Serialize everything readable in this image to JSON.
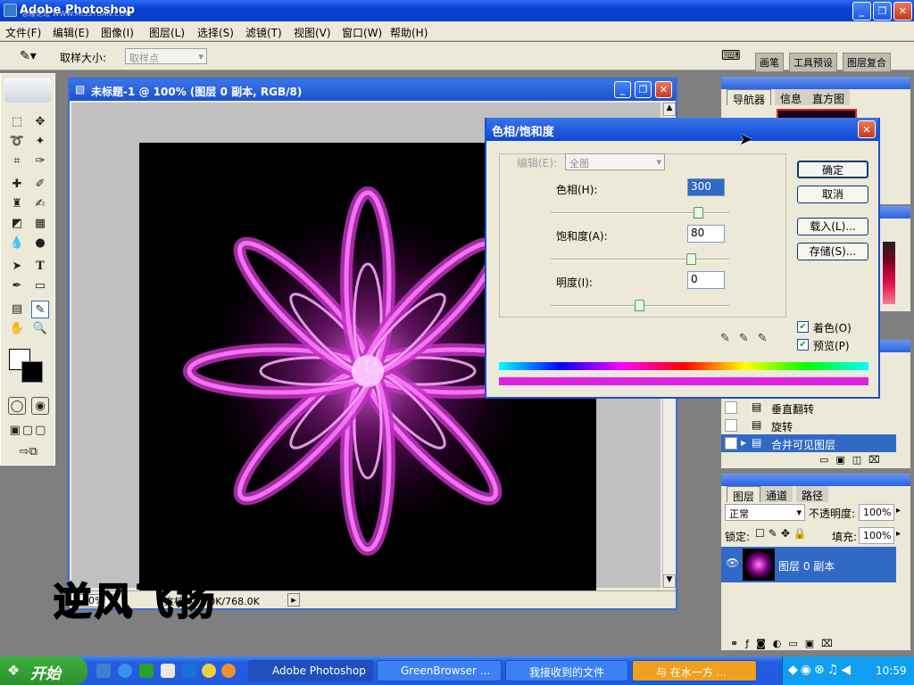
{
  "app": {
    "title": "Adobe Photoshop",
    "watermark": "思缘论坛 WWW.MISSYUAN.COM"
  },
  "menu": [
    "文件(F)",
    "编辑(E)",
    "图像(I)",
    "图层(L)",
    "选择(S)",
    "滤镜(T)",
    "视图(V)",
    "窗口(W)",
    "帮助(H)"
  ],
  "options": {
    "sample_size_label": "取样大小:",
    "sample_size_value": "取样点",
    "right_tabs": [
      "画笔",
      "工具预设",
      "图层复合"
    ]
  },
  "document": {
    "title": "未标题-1 @ 100% (图层 0 副本, RGB/8)",
    "zoom": "100%",
    "doc_info": "文档:768.0K/768.0K",
    "overlay_text": "逆风飞扬"
  },
  "dialog": {
    "title": "色相/饱和度",
    "edit_label": "编辑(E):",
    "edit_value": "全图",
    "hue_label": "色相(H):",
    "hue_value": "300",
    "saturation_label": "饱和度(A):",
    "saturation_value": "80",
    "lightness_label": "明度(I):",
    "lightness_value": "0",
    "ok": "确定",
    "cancel": "取消",
    "load": "载入(L)...",
    "save": "存储(S)...",
    "colorize": "着色(O)",
    "preview": "预览(P)",
    "hue_pos": 0.83,
    "sat_pos": 0.79,
    "light_pos": 0.5
  },
  "navigator": {
    "tabs": [
      "导航器",
      "信息",
      "直方图"
    ]
  },
  "actions": {
    "items": [
      "垂直翻转",
      "旋转",
      "合并可见图层"
    ]
  },
  "layers": {
    "tabs": [
      "图层",
      "通道",
      "路径"
    ],
    "blend_mode": "正常",
    "opacity_label": "不透明度:",
    "opacity_value": "100%",
    "lock_label": "锁定:",
    "fill_label": "填充:",
    "fill_value": "100%",
    "layer_name": "图层 0 副本"
  },
  "taskbar": {
    "start": "开始",
    "tasks": [
      "Adobe Photoshop",
      "GreenBrowser ...",
      "我接收到的文件",
      "与 在水一方 ..."
    ],
    "clock": "10:59"
  },
  "colors": {
    "accent": "#e040e0",
    "titlebar": "#0a3fd6"
  }
}
